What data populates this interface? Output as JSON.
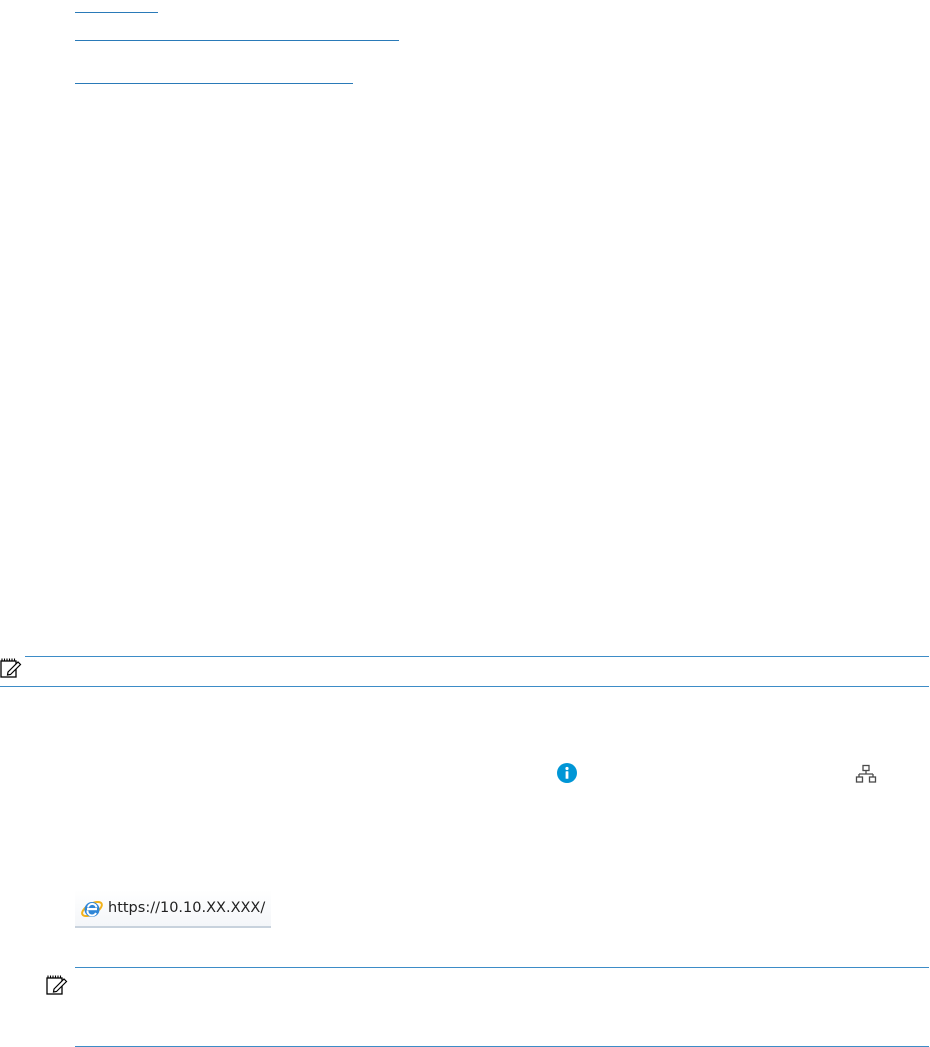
{
  "browser": {
    "address_url": "https://10.10.XX.XXX/",
    "icon": "internet-explorer-icon"
  },
  "icons": {
    "note": "note-pad-pencil-icon",
    "info": "info-icon",
    "network": "network-icon"
  },
  "colors": {
    "link": "#2a7ab8",
    "rule": "#3d8cc7",
    "info_icon": "#0096d6",
    "network_icon": "#4a4a4a",
    "address_bar_border": "#c8d2dd"
  }
}
